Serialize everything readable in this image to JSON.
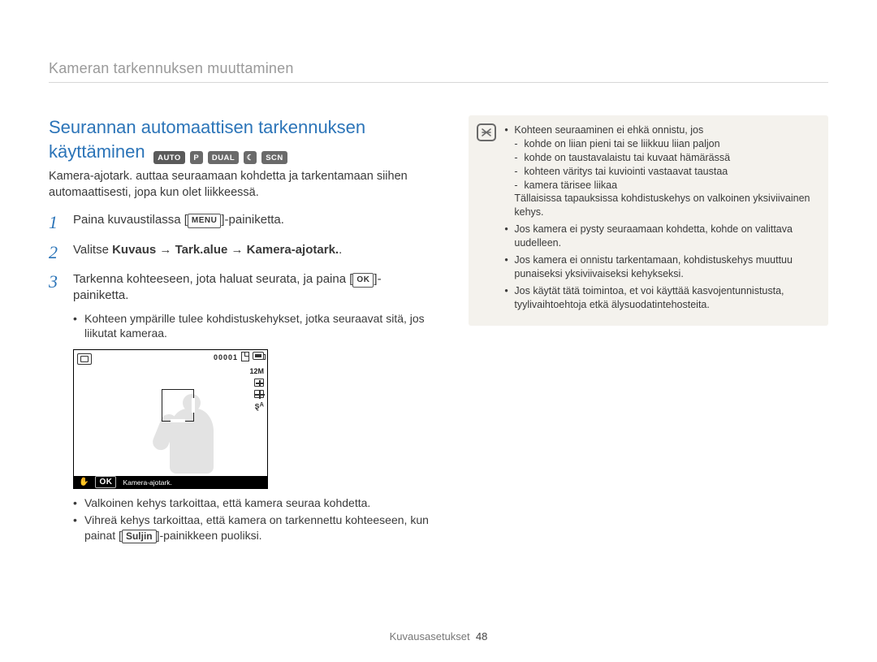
{
  "header": {
    "title": "Kameran tarkennuksen muuttaminen"
  },
  "section": {
    "title_line1": "Seurannan automaattisen tarkennuksen",
    "title_line2": "käyttäminen",
    "intro": "Kamera-ajotark. auttaa seuraamaan kohdetta ja tarkentamaan siihen automaattisesti, jopa kun olet liikkeessä."
  },
  "modes": {
    "auto": "AUTO",
    "p": "P",
    "dual": "DUAL",
    "moon": "☾",
    "scn": "SCN"
  },
  "steps": {
    "s1_a": "Paina kuvaustilassa [",
    "s1_kbd": "MENU",
    "s1_b": "]-painiketta.",
    "s2_a": "Valitse ",
    "s2_bold": "Kuvaus → Tark.alue → Kamera-ajotark.",
    "s2_b": ".",
    "s3_a": "Tarkenna kohteeseen, jota haluat seurata, ja paina [",
    "s3_kbd": "OK",
    "s3_b": "]-painiketta."
  },
  "sub": {
    "b1": "Kohteen ympärille tulee kohdistuskehykset, jotka seuraavat sitä, jos liikutat kameraa."
  },
  "camera": {
    "counter": "00001",
    "size_label": "12M",
    "flash": "ȿᴬ",
    "ok": "OK",
    "mode_label": "Kamera-ajotark."
  },
  "bullets_after": {
    "b1": "Valkoinen kehys tarkoittaa, että kamera seuraa kohdetta.",
    "b2_a": "Vihreä kehys tarkoittaa, että kamera on tarkennettu kohteeseen, kun painat [",
    "b2_key": "Suljin",
    "b2_b": "]-painikkeen puoliksi."
  },
  "note": {
    "items": {
      "i1_head": "Kohteen seuraaminen ei ehkä onnistu, jos",
      "i1_sub1": "kohde on liian pieni tai se liikkuu liian paljon",
      "i1_sub2": "kohde on taustavalaistu tai kuvaat hämärässä",
      "i1_sub3": "kohteen väritys tai kuviointi vastaavat taustaa",
      "i1_sub4": "kamera tärisee liikaa",
      "i1_tail": "Tällaisissa tapauksissa kohdistuskehys on valkoinen yksiviivainen kehys.",
      "i2": "Jos kamera ei pysty seuraamaan kohdetta, kohde on valittava uudelleen.",
      "i3": "Jos kamera ei onnistu tarkentamaan, kohdistuskehys muuttuu punaiseksi yksiviivaiseksi kehykseksi.",
      "i4": "Jos käytät tätä toimintoa, et voi käyttää kasvojentunnistusta, tyylivaihtoehtoja etkä älysuodatintehosteita."
    }
  },
  "footer": {
    "section": "Kuvausasetukset",
    "page": "48"
  }
}
